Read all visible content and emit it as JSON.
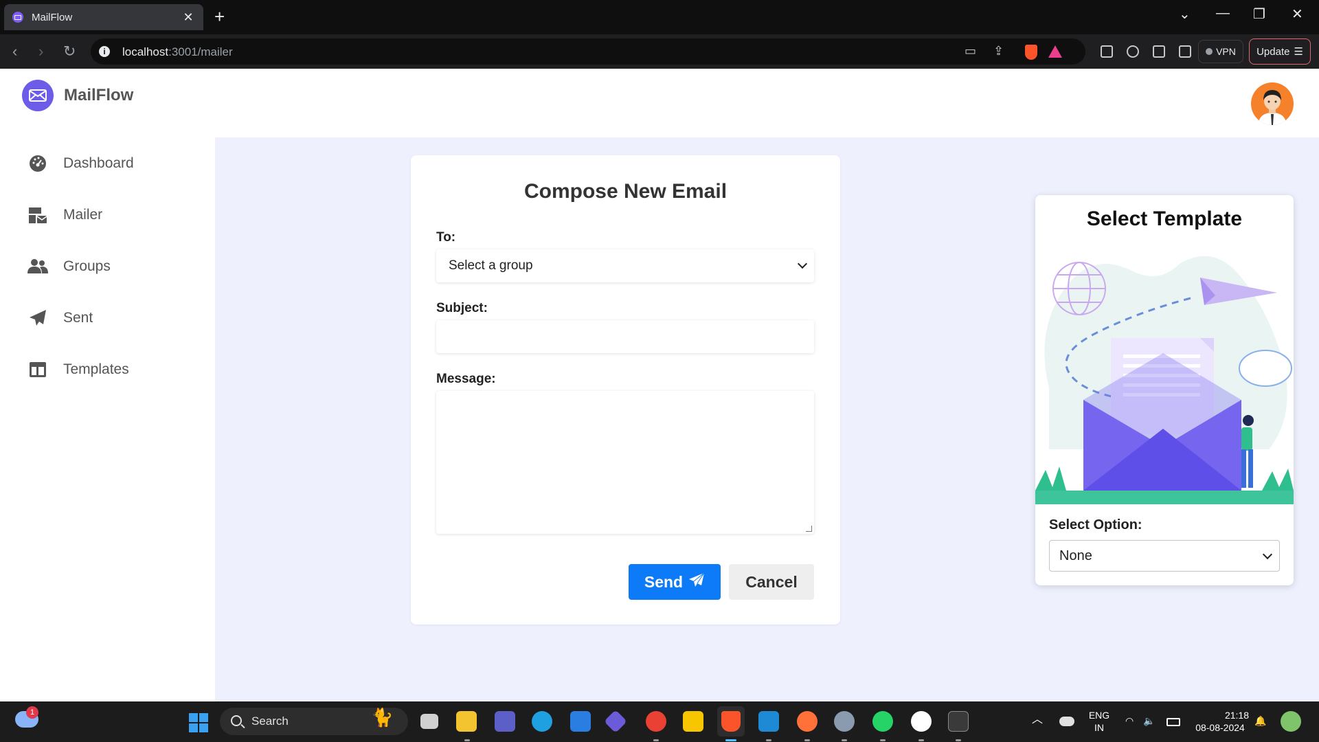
{
  "browser": {
    "tab_title": "MailFlow",
    "tab_close": "✕",
    "new_tab": "+",
    "url_host": "localhost",
    "url_rest": ":3001/mailer",
    "vpn_label": "VPN",
    "update_label": "Update"
  },
  "app": {
    "brand": "MailFlow",
    "nav": [
      {
        "label": "Dashboard",
        "icon": "dashboard-icon"
      },
      {
        "label": "Mailer",
        "icon": "mailer-icon"
      },
      {
        "label": "Groups",
        "icon": "groups-icon"
      },
      {
        "label": "Sent",
        "icon": "paper-plane-icon"
      },
      {
        "label": "Templates",
        "icon": "templates-icon"
      }
    ]
  },
  "compose": {
    "title": "Compose New Email",
    "to_label": "To:",
    "to_selected": "Select a group",
    "subject_label": "Subject:",
    "subject_value": "",
    "message_label": "Message:",
    "message_value": "",
    "send_label": "Send",
    "cancel_label": "Cancel"
  },
  "template": {
    "title": "Select Template",
    "option_label": "Select Option:",
    "option_selected": "None"
  },
  "taskbar": {
    "weather_badge": "1",
    "search_placeholder": "Search",
    "lang_top": "ENG",
    "lang_bottom": "IN",
    "time": "21:18",
    "date": "08-08-2024"
  },
  "colors": {
    "brand": "#6c5ce7",
    "send_button": "#0d7bf7",
    "content_bg": "#eef1fd"
  }
}
